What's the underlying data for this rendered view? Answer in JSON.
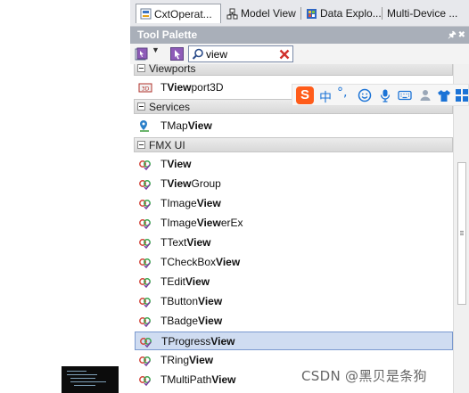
{
  "tabs": [
    {
      "label": "CxtOperat..."
    },
    {
      "label": "Model View"
    },
    {
      "label": "Data Explo..."
    },
    {
      "label": "Multi-Device ..."
    }
  ],
  "palette": {
    "title": "Tool Palette",
    "search": {
      "value": "view",
      "placeholder": ""
    }
  },
  "categories": {
    "viewports": "Viewports",
    "services": "Services",
    "fmx": "FMX UI"
  },
  "items": {
    "viewport3d": {
      "pre": "T",
      "bold": "View",
      "post": "port3D",
      "badge": "3D"
    },
    "mapview": {
      "pre": "TMap",
      "bold": "View",
      "post": ""
    },
    "view": {
      "pre": "T",
      "bold": "View",
      "post": ""
    },
    "viewgroup": {
      "pre": "T",
      "bold": "View",
      "post": "Group"
    },
    "imageview": {
      "pre": "TImage",
      "bold": "View",
      "post": ""
    },
    "imageviewerex": {
      "pre": "TImage",
      "bold": "View",
      "post": "erEx"
    },
    "textview": {
      "pre": "TText",
      "bold": "View",
      "post": ""
    },
    "checkboxview": {
      "pre": "TCheckBox",
      "bold": "View",
      "post": ""
    },
    "editview": {
      "pre": "TEdit",
      "bold": "View",
      "post": ""
    },
    "buttonview": {
      "pre": "TButton",
      "bold": "View",
      "post": ""
    },
    "badgeview": {
      "pre": "TBadge",
      "bold": "View",
      "post": ""
    },
    "progressview": {
      "pre": "TProgress",
      "bold": "View",
      "post": ""
    },
    "ringview": {
      "pre": "TRing",
      "bold": "View",
      "post": ""
    },
    "multipathview": {
      "pre": "TMultiPath",
      "bold": "View",
      "post": ""
    }
  },
  "ime": {
    "logo": "S",
    "mode": "中",
    "punct": "°,"
  },
  "watermark": "CSDN @黑贝是条狗",
  "colors": {
    "title_bar": "#a9afb9",
    "selection": "#cfdcf1",
    "ime_logo": "#ff5c1a",
    "ime_blue": "#1b73d6"
  }
}
